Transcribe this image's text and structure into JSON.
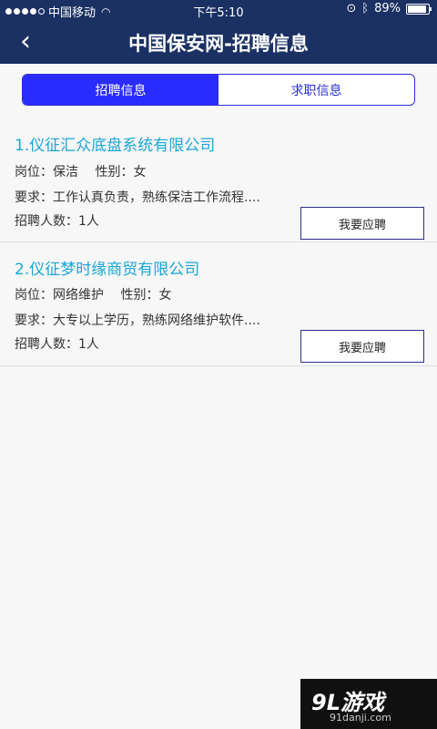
{
  "status": {
    "carrier": "中国移动",
    "time": "下午5:10",
    "battery": "89%",
    "battery_level": 0.89
  },
  "header": {
    "title": "中国保安网-招聘信息"
  },
  "tabs": [
    {
      "label": "招聘信息",
      "active": true
    },
    {
      "label": "求职信息",
      "active": false
    }
  ],
  "jobs": [
    {
      "company": "1.仪征汇众底盘系统有限公司",
      "position_line": "岗位：保洁　 性别：女",
      "requirement_line": "要求：工作认真负责，熟练保洁工作流程....",
      "headcount_line": "招聘人数：1人",
      "apply_label": "我要应聘"
    },
    {
      "company": "2.仪征梦时缘商贸有限公司",
      "position_line": "岗位：网络维护　 性别：女",
      "requirement_line": "要求：大专以上学历，熟练网络维护软件....",
      "headcount_line": "招聘人数：1人",
      "apply_label": "我要应聘"
    }
  ],
  "watermark": {
    "logo": "9L游戏",
    "url": "91danji.com"
  },
  "colors": {
    "header_bg": "#1b3163",
    "tab_active": "#2a2bff",
    "company_text": "#1aa6d6"
  }
}
